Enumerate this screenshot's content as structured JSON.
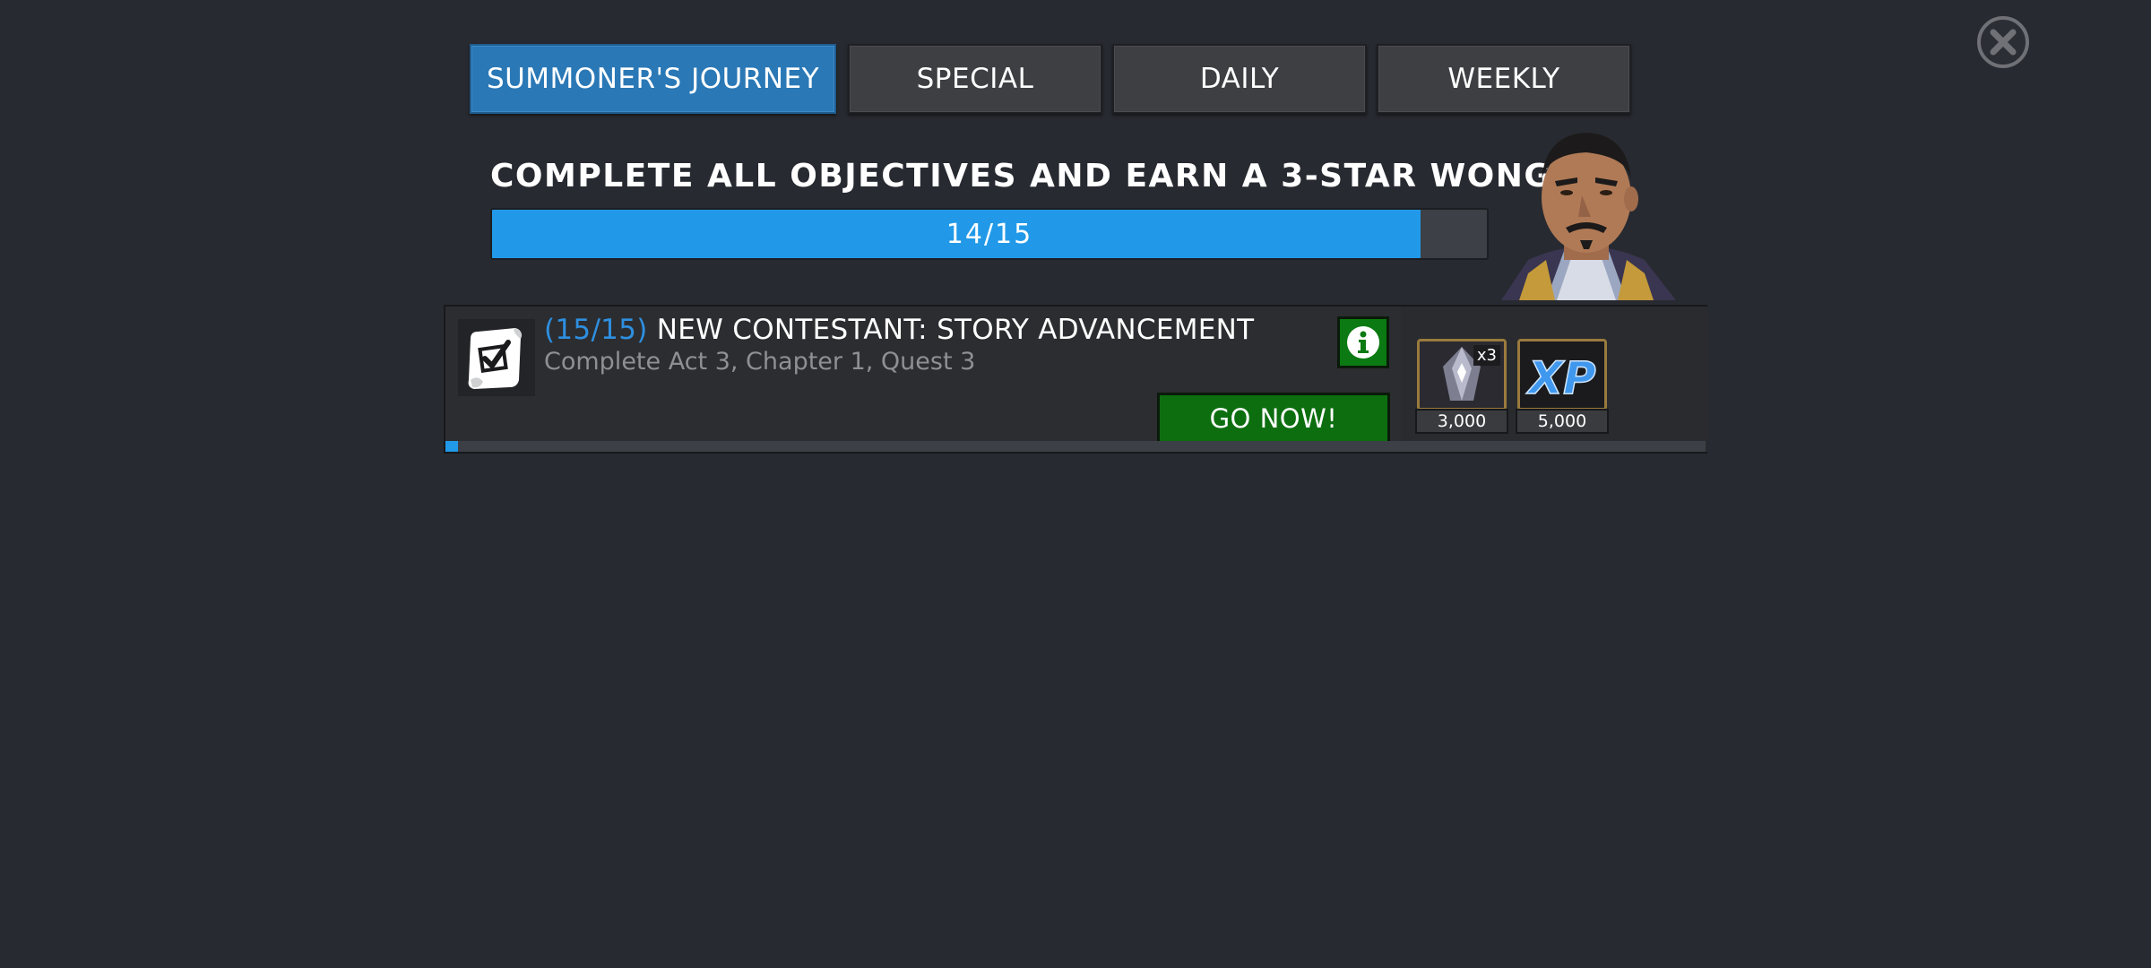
{
  "tabs": [
    {
      "label": "SUMMONER'S JOURNEY",
      "active": true
    },
    {
      "label": "SPECIAL",
      "active": false
    },
    {
      "label": "DAILY",
      "active": false
    },
    {
      "label": "WEEKLY",
      "active": false
    }
  ],
  "objective": {
    "title": "COMPLETE ALL OBJECTIVES AND EARN A 3-STAR WONG",
    "progress_text": "14/15",
    "progress_fraction": 0.933
  },
  "quest": {
    "count": "(15/15)",
    "title": " NEW CONTESTANT: STORY ADVANCEMENT",
    "subtitle": "Complete Act 3, Chapter 1, Quest 3",
    "go_label": "GO NOW!",
    "progress_fraction": 0.01,
    "rewards": [
      {
        "icon": "crystal-shard-icon",
        "multiplier": "x3",
        "amount": "3,000"
      },
      {
        "icon": "xp-icon",
        "amount": "5,000"
      }
    ]
  },
  "colors": {
    "background": "#272a30",
    "accent_blue": "#2199e8",
    "go_green": "#0d6e10",
    "active_tab": "#2a78b6"
  },
  "icons": {
    "close": "close-icon",
    "quest": "scroll-checkmark-icon",
    "info": "info-icon",
    "portrait": "wong-portrait"
  }
}
